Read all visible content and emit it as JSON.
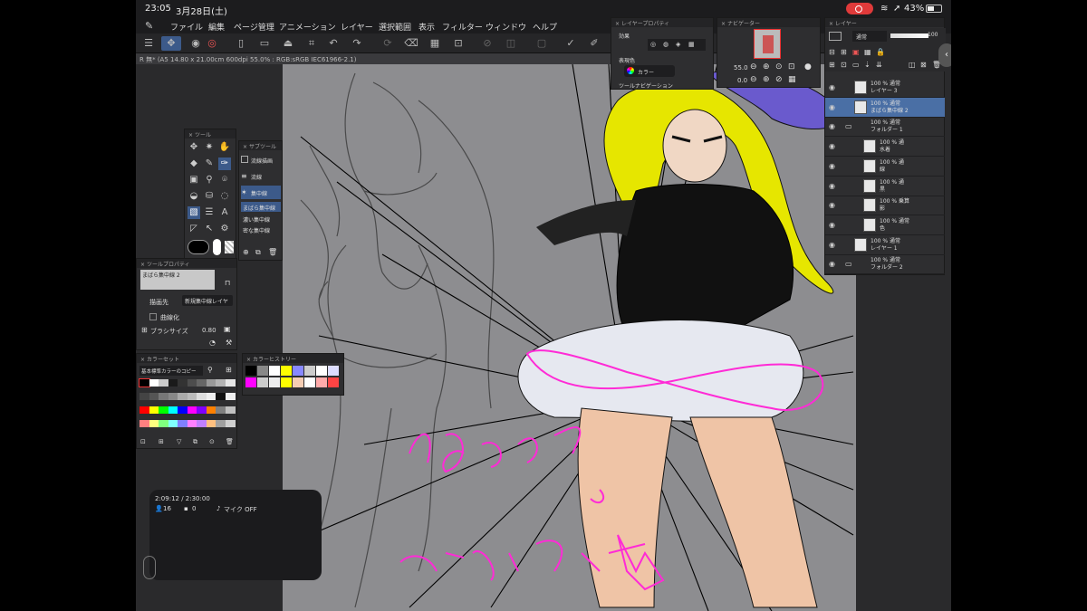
{
  "status": {
    "time": "23:05",
    "date": "3月28日(土)",
    "battery": "43%"
  },
  "menu": [
    "ファイル",
    "編集",
    "ページ管理",
    "アニメーション",
    "レイヤー",
    "選択範囲",
    "表示",
    "フィルター",
    "ウィンドウ",
    "ヘルプ"
  ],
  "document": {
    "info": "R 無* (A5 14.80 x 21.00cm 600dpi 55.0% : RGB:sRGB IEC61966-2.1)"
  },
  "tool_panel": {
    "title": "ツール"
  },
  "subtool_panel": {
    "title": "サブツール",
    "items": [
      "流線描画",
      "流線",
      "集中線",
      "まばら集中線",
      "濃い集中線",
      "密な集中線"
    ]
  },
  "tool_property": {
    "title": "ツールプロパティ",
    "preview_label": "まばら集中線 2",
    "draw_target_label": "描画先",
    "draw_target_value": "新規集中線レイヤ",
    "curve_label": "曲線化",
    "brush_size_label": "ブラシサイズ",
    "brush_size_value": "0.80"
  },
  "color_set": {
    "title": "カラーセット",
    "set_name": "基本標準カラーのコピー",
    "colors": [
      "#000000",
      "#ffffff",
      "#cccccc",
      "#1a1a1a",
      "#333333",
      "#4d4d4d",
      "#666666",
      "#999999",
      "#b3b3b3",
      "#e6e6e6",
      "#444444",
      "#555555",
      "#777777",
      "#888888",
      "#aaaaaa",
      "#bbbbbb",
      "#dddddd",
      "#eeeeee",
      "#111111",
      "#f0f0f0",
      "#ff0000",
      "#ffff00",
      "#00ff00",
      "#00ffff",
      "#0000ff",
      "#ff00ff",
      "#8000ff",
      "#ff8000",
      "#808080",
      "#c0c0c0",
      "#ff8080",
      "#ffff80",
      "#80ff80",
      "#80ffff",
      "#8080ff",
      "#ff80ff",
      "#c080ff",
      "#ffc080",
      "#a0a0a0",
      "#d0d0d0"
    ]
  },
  "color_history": {
    "title": "カラーヒストリー",
    "colors": [
      "#000000",
      "#888888",
      "#ffffff",
      "#ffff00",
      "#8888ff",
      "#cccccc",
      "#ffffff",
      "#ddddff",
      "#ff00ff",
      "#cccccc",
      "#eeeeee",
      "#ffff00",
      "#f5cdb4",
      "#ffffff",
      "#ffaaaa",
      "#ff4444"
    ]
  },
  "stream": {
    "timer": "2:09:12 / 2:30:00",
    "viewers": "16",
    "comments": "0",
    "mic": "マイク OFF"
  },
  "layer_property": {
    "title": "レイヤープロパティ",
    "effect_label": "効果",
    "expression_label": "表現色",
    "expression_value": "カラー",
    "tool_nav_label": "ツールナビゲーション"
  },
  "navigator": {
    "title": "ナビゲーター",
    "zoom": "55.0",
    "rotation": "0.0"
  },
  "layer_panel": {
    "title": "レイヤー",
    "blend_mode": "通常",
    "opacity": "100",
    "layers": [
      {
        "pct": "100 %",
        "mode": "通常",
        "name": "レイヤー 3"
      },
      {
        "pct": "100 %",
        "mode": "通常",
        "name": "まばら集中線 2"
      },
      {
        "pct": "100 %",
        "mode": "通常",
        "name": "フォルダー 1"
      },
      {
        "pct": "100 %",
        "mode": "通",
        "name": "水着"
      },
      {
        "pct": "100 %",
        "mode": "通",
        "name": "線"
      },
      {
        "pct": "100 %",
        "mode": "通",
        "name": "黒"
      },
      {
        "pct": "100 %",
        "mode": "乗算",
        "name": "影"
      },
      {
        "pct": "100 %",
        "mode": "通常",
        "name": "色"
      },
      {
        "pct": "100 %",
        "mode": "通常",
        "name": "レイヤー 1"
      },
      {
        "pct": "100 %",
        "mode": "通常",
        "name": "フォルダー 2"
      }
    ]
  },
  "colors": {
    "accent": "#4a6fa5",
    "highlight": "#ff2bd6",
    "record": "#e03a3a"
  }
}
